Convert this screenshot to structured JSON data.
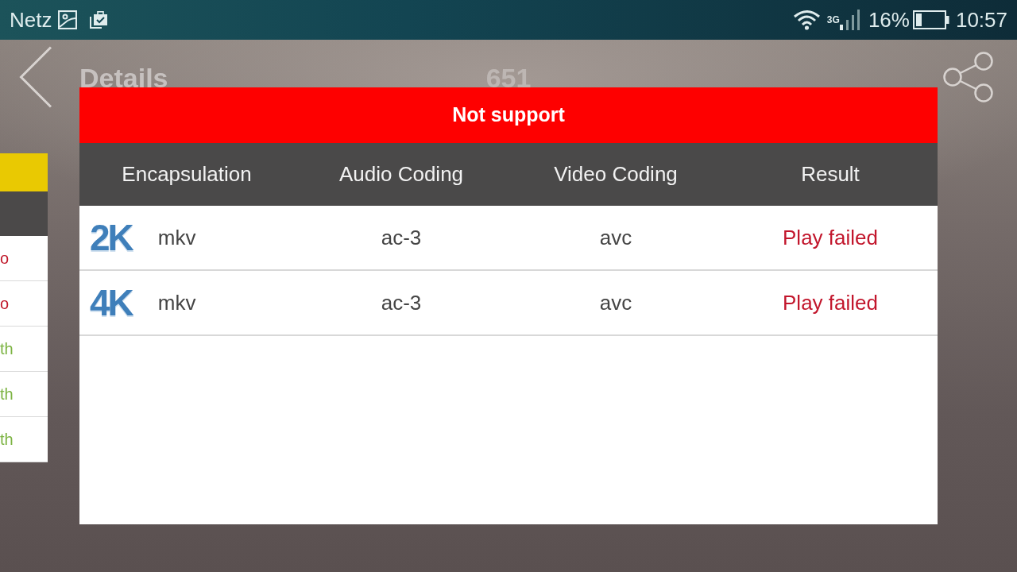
{
  "status_bar": {
    "carrier": "Netz",
    "network_type": "3G",
    "battery": "16%",
    "time": "10:57"
  },
  "app_bar": {
    "title": "Details",
    "count": "651"
  },
  "side_list": {
    "items": [
      {
        "text": "o",
        "color": "#c0182a"
      },
      {
        "text": "o",
        "color": "#c0182a"
      },
      {
        "text": "th",
        "color": "#7cb342"
      },
      {
        "text": "th",
        "color": "#7cb342"
      },
      {
        "text": "th",
        "color": "#7cb342"
      }
    ]
  },
  "dialog": {
    "title": "Not support",
    "columns": [
      "Encapsulation",
      "Audio Coding",
      "Video Coding",
      "Result"
    ],
    "rows": [
      {
        "resolution": "2K",
        "encapsulation": "mkv",
        "audio_coding": "ac-3",
        "video_coding": "avc",
        "result": "Play failed"
      },
      {
        "resolution": "4K",
        "encapsulation": "mkv",
        "audio_coding": "ac-3",
        "video_coding": "avc",
        "result": "Play failed"
      }
    ]
  }
}
